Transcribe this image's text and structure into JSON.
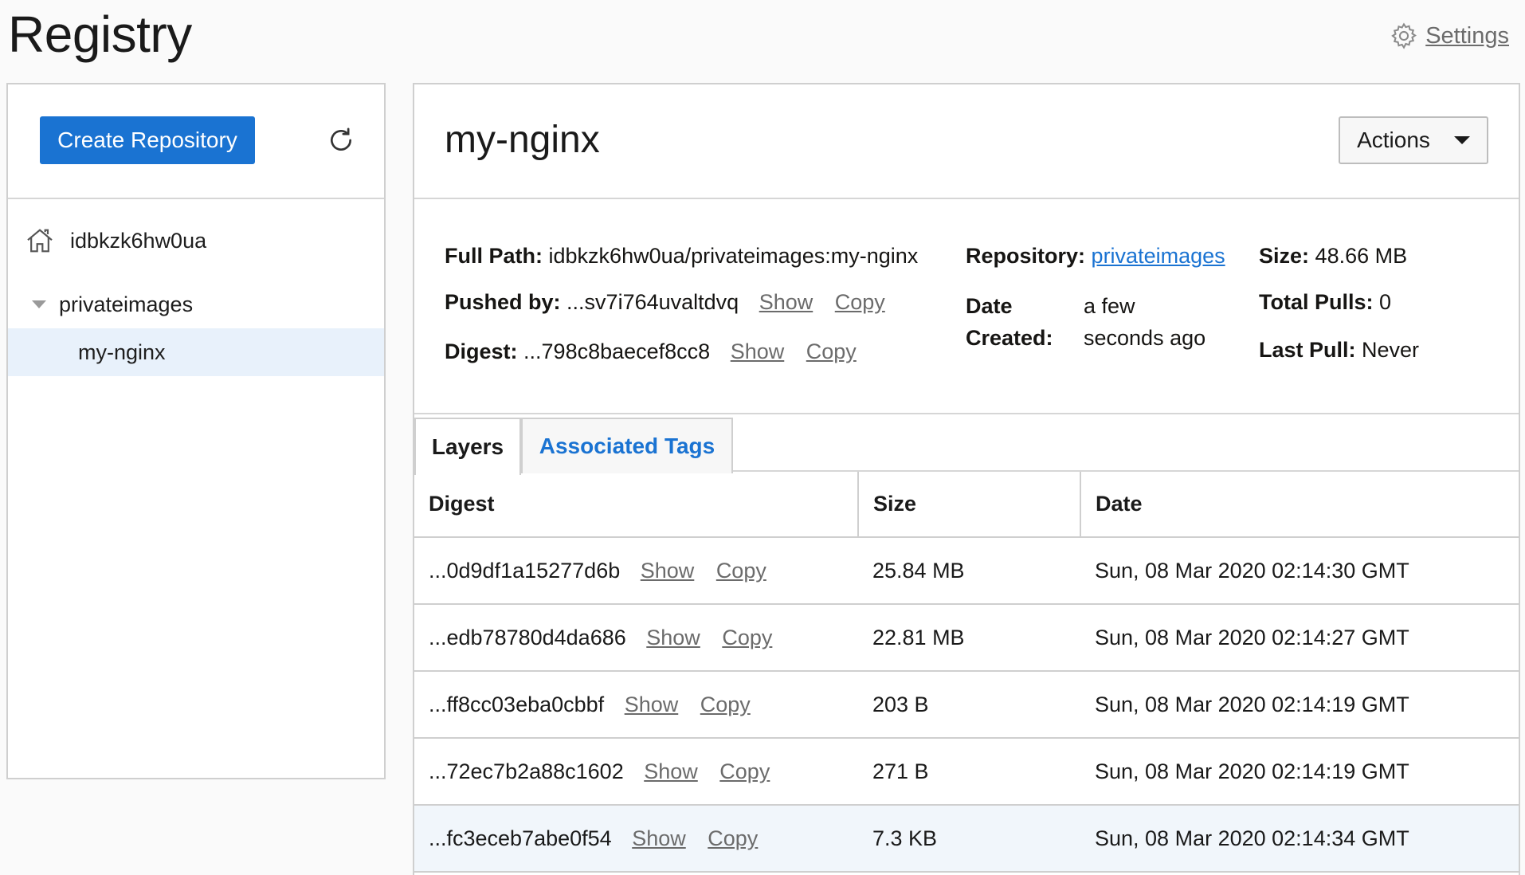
{
  "page": {
    "title": "Registry",
    "settings_label": "Settings"
  },
  "sidebar": {
    "create_button": "Create Repository",
    "root": "idbkzk6hw0ua",
    "folder": "privateimages",
    "selected_repo": "my-nginx"
  },
  "detail": {
    "title": "my-nginx",
    "actions_label": "Actions",
    "full_path_label": "Full Path:",
    "full_path": "idbkzk6hw0ua/privateimages:my-nginx",
    "pushed_by_label": "Pushed by:",
    "pushed_by": "...sv7i764uvaltdvq",
    "digest_label": "Digest:",
    "digest": "...798c8baecef8cc8",
    "repository_label": "Repository:",
    "repository": "privateimages",
    "date_created_label_1": "Date",
    "date_created_label_2": "Created:",
    "date_created_1": "a few",
    "date_created_2": "seconds ago",
    "size_label": "Size:",
    "size": "48.66 MB",
    "total_pulls_label": "Total Pulls:",
    "total_pulls": "0",
    "last_pull_label": "Last Pull:",
    "last_pull": "Never",
    "show_label": "Show",
    "copy_label": "Copy"
  },
  "tabs": [
    "Layers",
    "Associated Tags"
  ],
  "layers": {
    "columns": [
      "Digest",
      "Size",
      "Date"
    ],
    "rows": [
      {
        "digest": "...0d9df1a15277d6b",
        "size": "25.84 MB",
        "date": "Sun, 08 Mar 2020 02:14:30 GMT"
      },
      {
        "digest": "...edb78780d4da686",
        "size": "22.81 MB",
        "date": "Sun, 08 Mar 2020 02:14:27 GMT"
      },
      {
        "digest": "...ff8cc03eba0cbbf",
        "size": "203 B",
        "date": "Sun, 08 Mar 2020 02:14:19 GMT"
      },
      {
        "digest": "...72ec7b2a88c1602",
        "size": "271 B",
        "date": "Sun, 08 Mar 2020 02:14:19 GMT"
      },
      {
        "digest": "...fc3eceb7abe0f54",
        "size": "7.3 KB",
        "date": "Sun, 08 Mar 2020 02:14:34 GMT"
      }
    ]
  },
  "colors": {
    "primary": "#1a73d2",
    "selected_row": "#e8f1fb",
    "border": "#cfcfcf"
  }
}
